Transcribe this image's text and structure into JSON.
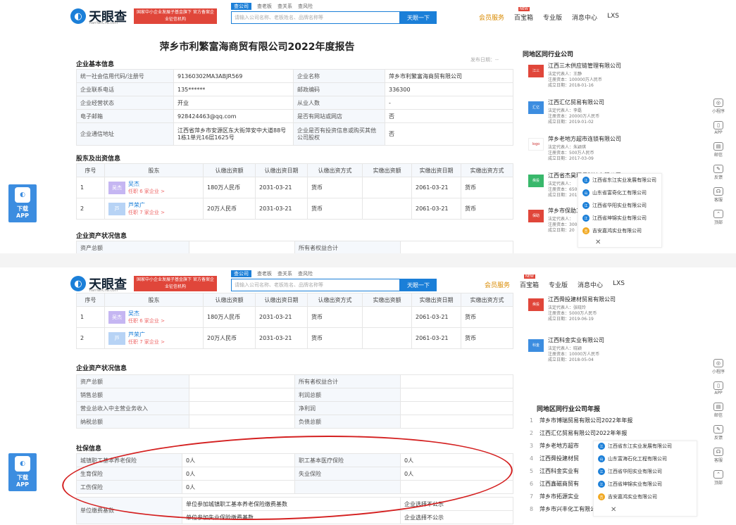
{
  "header": {
    "logo_text": "天眼查",
    "logo_sub": "TianYanCha.com",
    "promo_text": "国家中小企业发展子基金旗下 官方备案企业征信机构",
    "search_tabs": [
      "查公司",
      "查老板",
      "查关系",
      "查风险"
    ],
    "search_placeholder": "请输入公司名称、老板姓名、品牌名称等",
    "search_button": "天眼一下",
    "nav": [
      "会员服务",
      "百宝箱",
      "专业版",
      "消息中心",
      "LXS"
    ]
  },
  "report": {
    "title": "萍乡市利繁富海商贸有限公司2022年度报告",
    "share": "发布日期：--",
    "basic_info_title": "企业基本信息",
    "basic_rows": [
      [
        "统一社会信用代码/注册号",
        "91360302MA3ABJR569",
        "企业名称",
        "萍乡市利繁富海商贸有限公司"
      ],
      [
        "企业联系电话",
        "135******",
        "邮政编码",
        "336300"
      ],
      [
        "企业经营状态",
        "开业",
        "从业人数",
        "-"
      ],
      [
        "电子邮箱",
        "928424463@qq.com",
        "是否有网站或网店",
        "否"
      ],
      [
        "企业通信地址",
        "江西省萍乡市安源区东大街萍安中大道88号1栋1单元16层1625号",
        "企业是否有投资信息或购买其他公司股权",
        "否"
      ]
    ],
    "shareholder_title": "股东及出资信息",
    "shareholder_headers": [
      "序号",
      "股东",
      "认缴出资额",
      "认缴出资日期",
      "认缴出资方式",
      "实缴出资额",
      "实缴出资日期",
      "实缴出资方式"
    ],
    "shareholders": [
      {
        "no": "1",
        "avatar": "吴杰",
        "name": "吴杰",
        "tag": "任职 6 家企业 >",
        "amount": "180万人民币",
        "date": "2031-03-21",
        "method": "货币",
        "paid": "",
        "paid_date": "2061-03-21",
        "paid_method": "货币"
      },
      {
        "no": "2",
        "avatar": "芦",
        "name": "芦荣广",
        "tag": "任职 7 家企业 >",
        "amount": "20万人民币",
        "date": "2031-03-21",
        "method": "货币",
        "paid": "",
        "paid_date": "2061-03-21",
        "paid_method": "货币"
      }
    ],
    "asset_title": "企业资产状况信息",
    "asset_rows": [
      [
        "资产总额",
        "",
        "所有者权益合计",
        ""
      ],
      [
        "销售总额",
        "",
        "利润总额",
        ""
      ],
      [
        "营业总收入中主营业务收入",
        "",
        "净利润",
        ""
      ],
      [
        "纳税总额",
        "",
        "负债总额",
        ""
      ]
    ],
    "social_title": "社保信息",
    "social_rows": [
      [
        "城镇职工基本养老保险",
        "0人",
        "职工基本医疗保险",
        "0人"
      ],
      [
        "生育保险",
        "0人",
        "失业保险",
        "0人"
      ],
      [
        "工伤保险",
        "0人",
        "",
        ""
      ]
    ],
    "payment_label": "单位缴费基数",
    "payment_rows": [
      [
        "单位参加城镇职工基本养老保险缴费基数",
        "企业选择不公示"
      ],
      [
        "单位参加失业保险缴费基数",
        "企业选择不公示"
      ]
    ]
  },
  "sidebar": {
    "same_region_title": "同地区同行业公司",
    "companies_top": [
      {
        "badge": "江三",
        "badge_color": "#e0463a",
        "name": "江西三木供应链管理有限公司",
        "legal": "法定代表人：王静",
        "capital": "注册资本：100000万人民币",
        "date": "成立日期：2018-01-16"
      },
      {
        "badge": "汇亿",
        "badge_color": "#3c8de0",
        "name": "江西汇亿贸易有限公司",
        "legal": "法定代表人：李磊",
        "capital": "注册资本：20000万人民币",
        "date": "成立日期：2019-01-02"
      },
      {
        "badge": "logo",
        "badge_color": "#c33",
        "name": "萍乡老地方超市连锁有限公司",
        "legal": "法定代表人：朱颖琪",
        "capital": "注册资本：500万人民币",
        "date": "成立日期：2017-03-09"
      },
      {
        "badge": "舜投",
        "badge_color": "#38b86b",
        "name": "江西省杰昊环保科技有限公司",
        "legal": "法定代表人：",
        "capital": "注册资本：6500",
        "date": "成立日期：201"
      },
      {
        "badge": "保助",
        "badge_color": "#e0463a",
        "name": "萍乡市保助工",
        "legal": "法定代表人：",
        "capital": "注册资本：3000",
        "date": "成立日期：20"
      }
    ],
    "popup_rows": [
      {
        "icon": "江",
        "text": "江西省东江实业发展有限公司"
      },
      {
        "icon": "山",
        "text": "山东省富奇化工有限公司"
      },
      {
        "icon": "江",
        "text": "江西省华阳实业有限公司"
      },
      {
        "icon": "江",
        "text": "江西省坤锦实业有限公司"
      },
      {
        "icon": "吉",
        "text": "吉安嘉鸿实业有限公司"
      }
    ],
    "companies_bottom": [
      {
        "badge": "舜投",
        "badge_color": "#e0463a",
        "name": "江西舜投建材贸易有限公司",
        "legal": "法定代表人：张晓玲",
        "capital": "注册资本：5000万人民币",
        "date": "成立日期：2019-06-19"
      },
      {
        "badge": "科金",
        "badge_color": "#3c8de0",
        "name": "江西科金实业有限公司",
        "legal": "法定代表人：晓颖",
        "capital": "注册资本：10000万人民币",
        "date": "成立日期：2018-05-04"
      }
    ],
    "annual_title": "同地区同行业公司年报",
    "annual_list": [
      "萍乡市博瑞贸易有限公司2022年年报",
      "江西汇亿贸易有限公司2022年年报",
      "萍乡老地方超市",
      "江西舜投建材贸",
      "江西科金实业有",
      "江西鑫磁商贸有",
      "萍乡市拓源实业",
      "萍乡市兴丰化工有限公司2022..."
    ],
    "annual_popup": [
      {
        "icon": "江",
        "text": "江西省东江实业发展有限公司"
      },
      {
        "icon": "山",
        "text": "山东富海石化工程有限公司"
      },
      {
        "icon": "江",
        "text": "江西省华阳实业有限公司"
      },
      {
        "icon": "江",
        "text": "江西省坤锦实业有限公司"
      },
      {
        "icon": "吉",
        "text": "吉安嘉鸿实业有限公司"
      }
    ]
  },
  "rail": [
    "小程序",
    "APP",
    "邮信",
    "反馈",
    "客服",
    "顶部"
  ],
  "left_app": {
    "line1": "下载",
    "line2": "APP"
  }
}
